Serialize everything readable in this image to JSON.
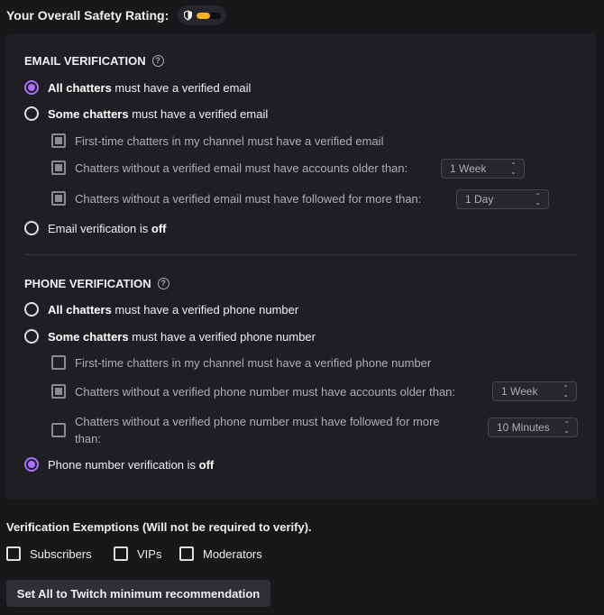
{
  "rating": {
    "label": "Your Overall Safety Rating:",
    "level_fraction": 0.55,
    "fill_color": "#f5b024",
    "icon": "shield-icon"
  },
  "email": {
    "title": "EMAIL VERIFICATION",
    "help_icon": "?",
    "opt_all_bold": "All chatters",
    "opt_all_rest": " must have a verified email",
    "opt_some_bold": "Some chatters",
    "opt_some_rest": " must have a verified email",
    "sub_first_time": "First-time chatters in my channel must have a verified email",
    "sub_account_age": "Chatters without a verified email must have accounts older than:",
    "sub_account_age_value": "1 Week",
    "sub_followed": "Chatters without a verified email must have followed for more than:",
    "sub_followed_value": "1 Day",
    "opt_off_text": "Email verification is ",
    "opt_off_bold": "off",
    "selected": "all"
  },
  "phone": {
    "title": "PHONE VERIFICATION",
    "help_icon": "?",
    "opt_all_bold": "All chatters",
    "opt_all_rest": " must have a verified phone number",
    "opt_some_bold": "Some chatters",
    "opt_some_rest": " must have a verified phone number",
    "sub_first_time": "First-time chatters in my channel must have a verified phone number",
    "sub_account_age": "Chatters without a verified phone number must have accounts older than:",
    "sub_account_age_value": "1 Week",
    "sub_followed_line1": "Chatters without a verified phone number must have followed for more",
    "sub_followed_line2": "than:",
    "sub_followed_value": "10 Minutes",
    "opt_off_text": "Phone number verification is ",
    "opt_off_bold": "off",
    "selected": "off"
  },
  "exemptions": {
    "title": "Verification Exemptions (Will not be required to verify).",
    "subscribers": "Subscribers",
    "vips": "VIPs",
    "moderators": "Moderators"
  },
  "button": {
    "label": "Set All to Twitch minimum recommendation"
  }
}
